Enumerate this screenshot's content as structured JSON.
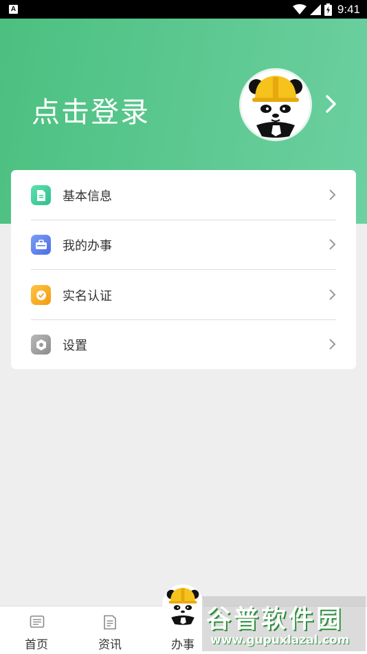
{
  "status_bar": {
    "notification_icon": "A",
    "icons": [
      "wifi-icon",
      "signal-icon",
      "battery-icon"
    ],
    "time": "9:41"
  },
  "header": {
    "login_text": "点击登录",
    "avatar_icon": "panda-worker-avatar",
    "arrow_icon": "chevron-right-icon",
    "gradient_colors": [
      "#4cc080",
      "#6cd0a0"
    ]
  },
  "menu": {
    "items": [
      {
        "label": "基本信息",
        "icon": "document-icon",
        "color": "#3fcf9a"
      },
      {
        "label": "我的办事",
        "icon": "case-icon",
        "color": "#5b7ef0"
      },
      {
        "label": "实名认证",
        "icon": "badge-check-icon",
        "color": "#f7a623"
      },
      {
        "label": "设置",
        "icon": "gear-icon",
        "color": "#9a9a9a"
      }
    ]
  },
  "bottom_nav": {
    "items": [
      {
        "label": "首页",
        "icon": "home-icon"
      },
      {
        "label": "资讯",
        "icon": "news-icon"
      },
      {
        "label": "办事",
        "icon": "panda-worker-avatar"
      }
    ]
  },
  "watermark": {
    "title": "谷普软件园",
    "url": "www.gupuxlazal.com"
  }
}
